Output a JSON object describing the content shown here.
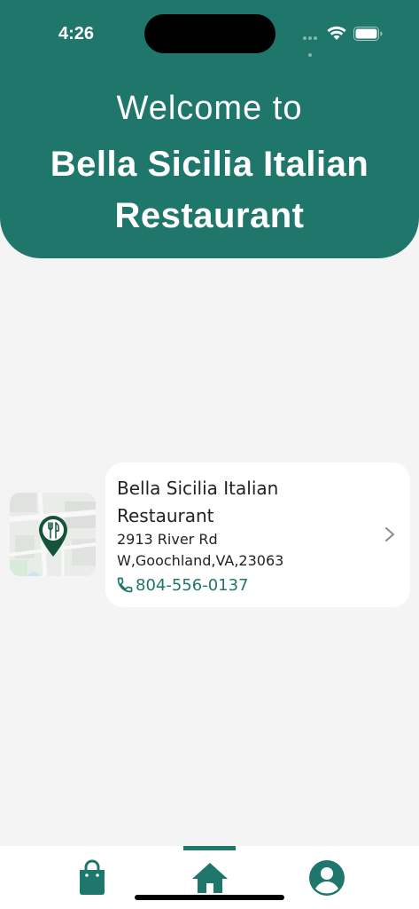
{
  "status_bar": {
    "time": "4:26"
  },
  "header": {
    "welcome": "Welcome to",
    "restaurant_name": "Bella Sicilia Italian Restaurant",
    "background_color": "#1f776c"
  },
  "restaurant_card": {
    "name": "Bella Sicilia Italian Restaurant",
    "address_line1": "2913 River Rd",
    "address_line2": "W,Goochland,VA,23063",
    "phone": "804-556-0137",
    "map_pin_icon": "fork-knife-pin-icon",
    "chevron_icon": "chevron-right-icon",
    "phone_icon": "phone-icon"
  },
  "tab_bar": {
    "tabs": [
      {
        "icon": "shopping-bag-icon",
        "active": false
      },
      {
        "icon": "home-icon",
        "active": true
      },
      {
        "icon": "account-icon",
        "active": false
      }
    ],
    "accent_color": "#1f776c"
  }
}
